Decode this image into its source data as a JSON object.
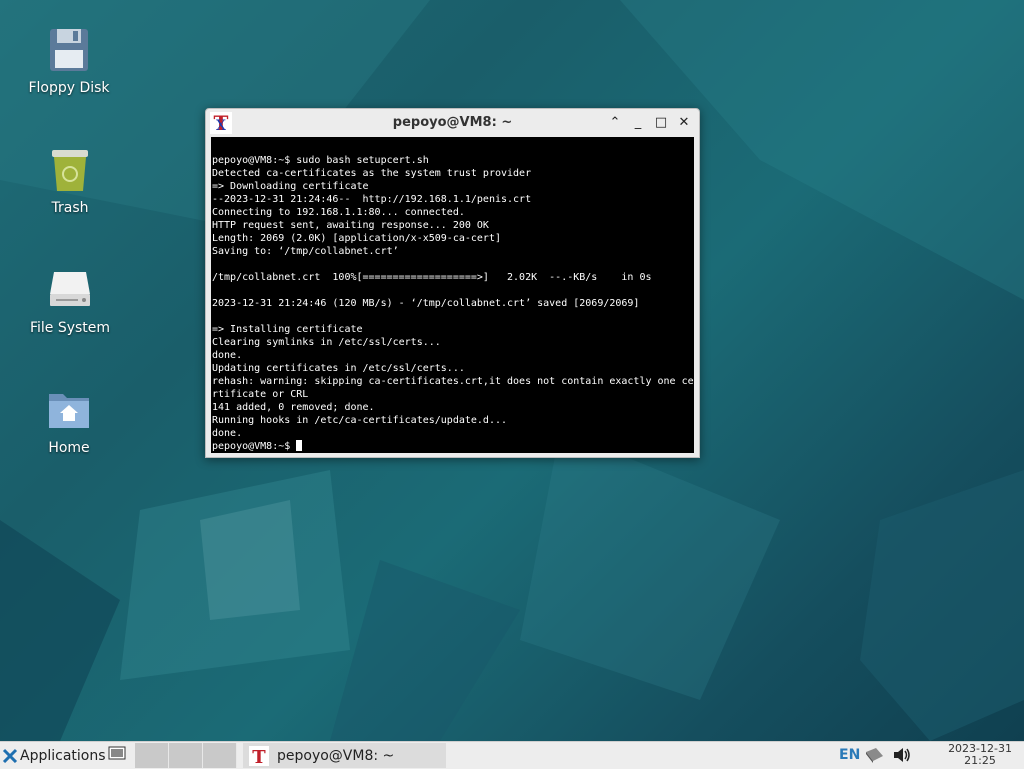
{
  "desktop": {
    "icons": [
      {
        "label": "Floppy Disk",
        "icon": "floppy-disk-icon"
      },
      {
        "label": "Trash",
        "icon": "trash-icon"
      },
      {
        "label": "File System",
        "icon": "hard-drive-icon"
      },
      {
        "label": "Home",
        "icon": "home-folder-icon"
      }
    ]
  },
  "terminal": {
    "title": "pepoyo@VM8: ~",
    "app_icon_glyph": "T",
    "controls": {
      "up": "⌃",
      "minimize": "_",
      "maximize": "□",
      "close": "✕"
    },
    "lines": [
      "pepoyo@VM8:~$ sudo bash setupcert.sh",
      "Detected ca-certificates as the system trust provider",
      "=> Downloading certificate",
      "--2023-12-31 21:24:46--  http://192.168.1.1/penis.crt",
      "Connecting to 192.168.1.1:80... connected.",
      "HTTP request sent, awaiting response... 200 OK",
      "Length: 2069 (2.0K) [application/x-x509-ca-cert]",
      "Saving to: ‘/tmp/collabnet.crt’",
      "",
      "/tmp/collabnet.crt  100%[===================>]   2.02K  --.-KB/s    in 0s",
      "",
      "2023-12-31 21:24:46 (120 MB/s) - ‘/tmp/collabnet.crt’ saved [2069/2069]",
      "",
      "=> Installing certificate",
      "Clearing symlinks in /etc/ssl/certs...",
      "done.",
      "Updating certificates in /etc/ssl/certs...",
      "rehash: warning: skipping ca-certificates.crt,it does not contain exactly one ce",
      "rtificate or CRL",
      "141 added, 0 removed; done.",
      "Running hooks in /etc/ca-certificates/update.d...",
      "done."
    ],
    "prompt": "pepoyo@VM8:~$ "
  },
  "taskbar": {
    "applications_label": "Applications",
    "task_label": "pepoyo@VM8: ~",
    "keyboard_layout": "EN",
    "date": "2023-12-31",
    "time": "21:25"
  },
  "colors": {
    "desktop_bg": "#1b6b76",
    "terminal_bg": "#000000",
    "terminal_fg": "#ffffff",
    "taskbar_bg": "#ededed",
    "keyboard_layout": "#2a7ab8"
  }
}
